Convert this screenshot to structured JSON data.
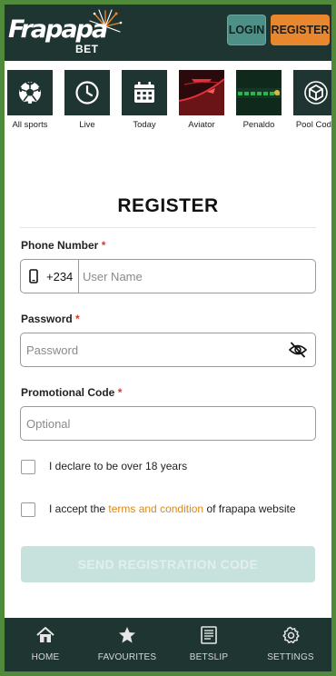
{
  "header": {
    "brand_name": "Frapapa",
    "brand_sub": "BET",
    "login_label": "LOGIN",
    "register_label": "REGISTER"
  },
  "categories": [
    {
      "label": "All sports",
      "icon": "soccer-ball-icon"
    },
    {
      "label": "Live",
      "icon": "clock-icon"
    },
    {
      "label": "Today",
      "icon": "calendar-icon"
    },
    {
      "label": "Aviator",
      "icon": "aviator-game-image"
    },
    {
      "label": "Penaldo",
      "icon": "penaldo-game-image"
    },
    {
      "label": "Pool Code",
      "icon": "cube-icon"
    }
  ],
  "form": {
    "title": "REGISTER",
    "phone": {
      "label": "Phone Number",
      "required": "*",
      "prefix": "+234",
      "placeholder": "User Name",
      "value": ""
    },
    "password": {
      "label": "Password",
      "required": "*",
      "placeholder": "Password",
      "value": ""
    },
    "promo": {
      "label": "Promotional Code",
      "required": "*",
      "placeholder": "Optional",
      "value": ""
    },
    "age_text": "I declare to be over 18 years",
    "terms_prefix": "I accept the ",
    "terms_link": "terms and condition",
    "terms_suffix": " of frapapa website",
    "send_label": "SEND REGISTRATION CODE"
  },
  "bottom_nav": [
    {
      "label": "HOME",
      "icon": "home-icon"
    },
    {
      "label": "FAVOURITES",
      "icon": "star-icon"
    },
    {
      "label": "BETSLIP",
      "icon": "betslip-icon"
    },
    {
      "label": "SETTINGS",
      "icon": "gear-icon"
    }
  ],
  "colors": {
    "header_bg": "#1f3531",
    "accent_orange": "#e8872e",
    "login_teal": "#4d9087",
    "link_orange": "#d98a1a",
    "send_button_disabled": "#c7e2dd",
    "required_red": "#d23a2a",
    "outer_border_green": "#4f8a3a"
  }
}
